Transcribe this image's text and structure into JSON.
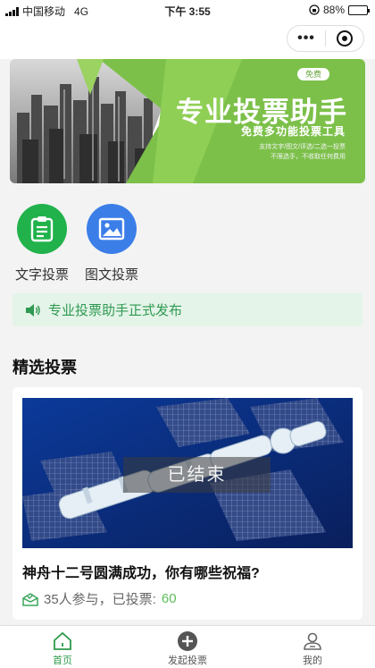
{
  "status_bar": {
    "carrier": "中国移动",
    "network": "4G",
    "time": "下午 3:55",
    "battery": "88%",
    "battery_level": 0.88
  },
  "capsule": {
    "more_label": "•••"
  },
  "banner": {
    "badge": "免费",
    "title": "专业投票助手",
    "subtitle": "免费多功能投票工具",
    "desc_line1": "支持文字/图文/评选/二选一投票",
    "desc_line2": "不限选手，不收取任何费用"
  },
  "quick_actions": [
    {
      "label": "文字投票",
      "icon": "clipboard-icon",
      "color": "#21b24b"
    },
    {
      "label": "图文投票",
      "icon": "image-icon",
      "color": "#3b7ee8"
    }
  ],
  "notice": {
    "text": "专业投票助手正式发布",
    "color": "#2f9a52"
  },
  "section": {
    "title": "精选投票"
  },
  "vote_card": {
    "status": "已结束",
    "title": "神舟十二号圆满成功，你有哪些祝福?",
    "participants_text": "35人参与，已投票:",
    "votes": "60"
  },
  "tab_bar": {
    "items": [
      {
        "label": "首页",
        "icon": "home-icon",
        "active": true
      },
      {
        "label": "发起投票",
        "icon": "plus-circle-icon",
        "active": false
      },
      {
        "label": "我的",
        "icon": "user-icon",
        "active": false
      }
    ],
    "active_color": "#2e9a4b"
  }
}
